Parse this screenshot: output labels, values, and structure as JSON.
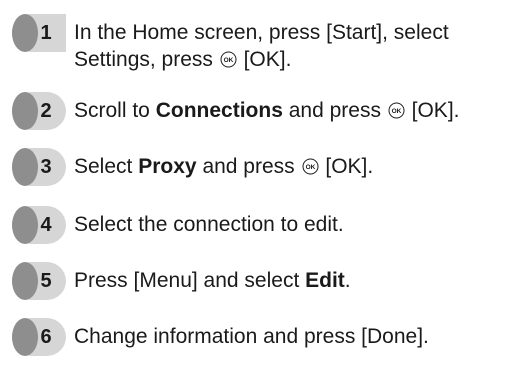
{
  "steps": [
    {
      "number": "1",
      "line1": "In the Home screen, press [Start], select",
      "line2_pre": "Settings, press",
      "line2_post": "[OK]."
    },
    {
      "number": "2",
      "pre": "Scroll to",
      "bold": "Connections",
      "post": "and press",
      "post2": "[OK]."
    },
    {
      "number": "3",
      "pre": "Select",
      "bold": "Proxy",
      "post": "and press",
      "post2": "[OK]."
    },
    {
      "number": "4",
      "text": "Select the connection to edit."
    },
    {
      "number": "5",
      "pre": "Press [Menu] and select",
      "bold": "Edit",
      "post": "."
    },
    {
      "number": "6",
      "text": "Change information and press [Done]."
    }
  ],
  "ok_icon": {
    "name": "ok-key-icon",
    "label": "OK"
  },
  "colors": {
    "badge_dark": "#8e8e8e",
    "badge_light": "#d6d6d6",
    "text": "#1a1a1a"
  }
}
